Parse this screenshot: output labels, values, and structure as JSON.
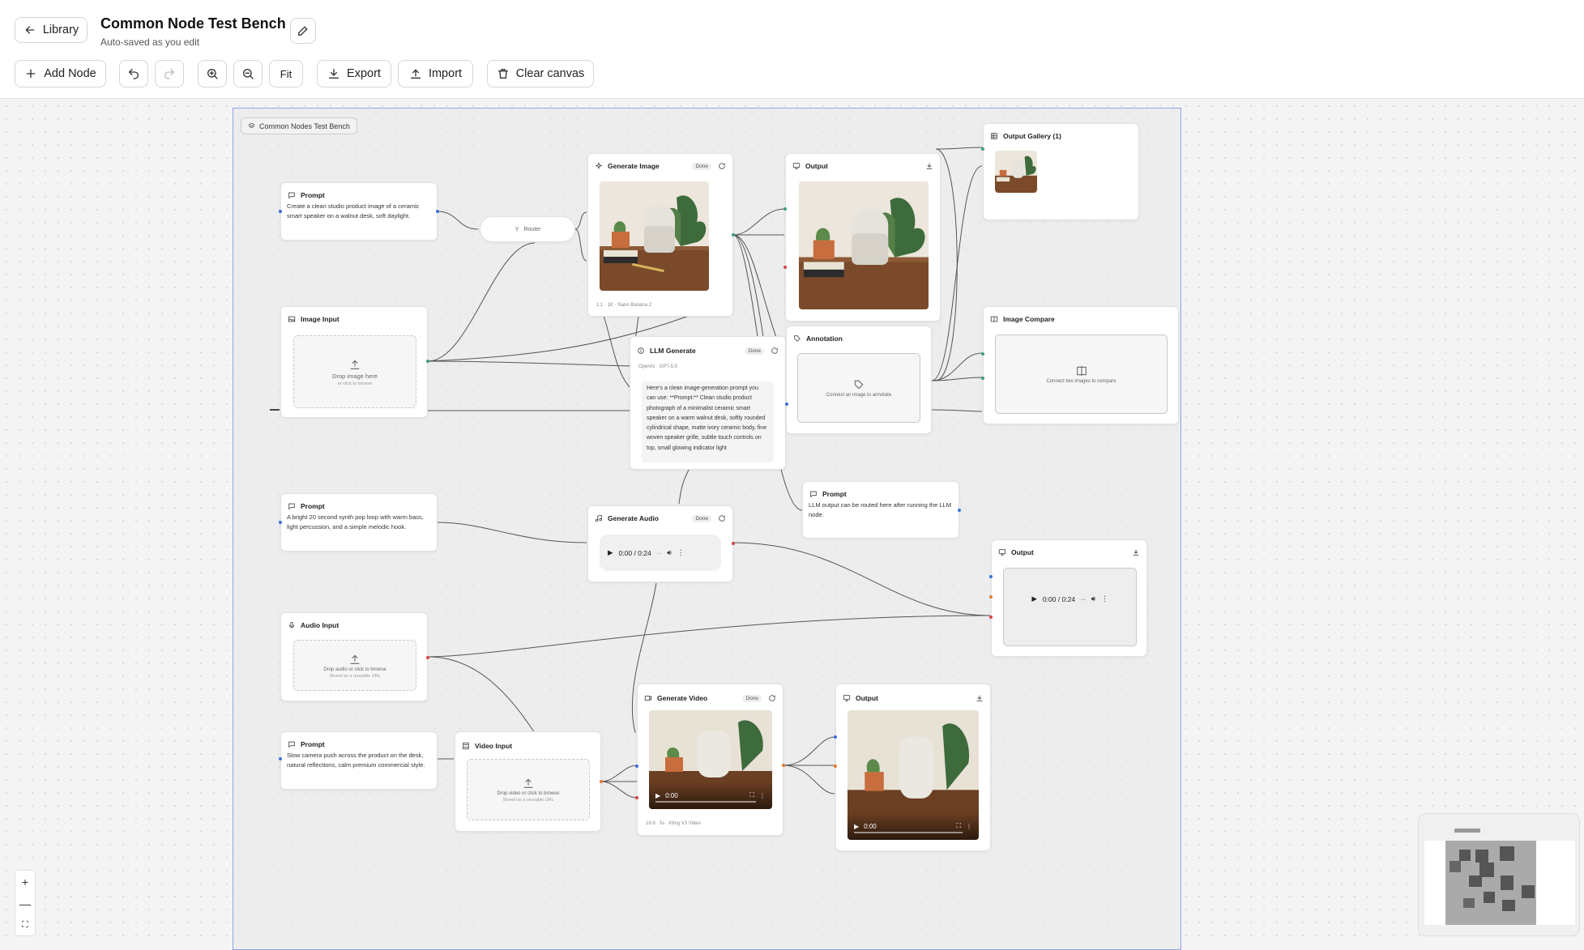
{
  "header": {
    "back_label": "Library",
    "title": "Common Node Test Bench",
    "subtitle": "Auto-saved as you edit"
  },
  "toolbar": {
    "add_node": "Add Node",
    "fit": "Fit",
    "export": "Export",
    "import": "Import",
    "clear": "Clear canvas"
  },
  "group": {
    "label": "Common Nodes Test Bench"
  },
  "nodes": {
    "prompt1": {
      "title": "Prompt",
      "text": "Create a clean studio product image of a ceramic smart speaker on a walnut desk, soft daylight."
    },
    "router": {
      "title": "Router"
    },
    "gen_image": {
      "title": "Generate Image",
      "status": "Done",
      "meta": [
        "1:1",
        "1K",
        "Nano Banana 2"
      ]
    },
    "output1": {
      "title": "Output"
    },
    "gallery": {
      "title": "Output Gallery (1)"
    },
    "image_input": {
      "title": "Image Input",
      "drop": "Drop image here",
      "drop_sub": "or click to browse"
    },
    "llm": {
      "title": "LLM Generate",
      "status": "Done",
      "model": "OpenAI · GPT-5.5",
      "text": "Here's a clean image-generation prompt you can use: **Prompt:** Clean studio product photograph of a minimalist ceramic smart speaker on a warm walnut desk, softly rounded cylindrical shape, matte ivory ceramic body, fine woven speaker grille, subtle touch controls on top, small glowing indicator light"
    },
    "annotation": {
      "title": "Annotation",
      "text": "Connect an image to annotate"
    },
    "compare": {
      "title": "Image Compare",
      "text": "Connect two images to compare"
    },
    "prompt_llm": {
      "title": "Prompt",
      "text": "LLM output can be routed here after running the LLM node."
    },
    "prompt2": {
      "title": "Prompt",
      "text": "A bright 20 second synth pop loop with warm bass, light percussion, and a simple melodic hook."
    },
    "gen_audio": {
      "title": "Generate Audio",
      "status": "Done",
      "time": "0:00 / 0:24"
    },
    "output_audio": {
      "title": "Output",
      "time": "0:00 / 0:24"
    },
    "audio_input": {
      "title": "Audio Input",
      "drop": "Drop audio or click to browse",
      "drop_sub": "Stored as a reusable URL"
    },
    "prompt3": {
      "title": "Prompt",
      "text": "Slow camera push across the product on the desk, natural reflections, calm premium commercial style."
    },
    "video_input": {
      "title": "Video Input",
      "drop": "Drop video or click to browse",
      "drop_sub": "Stored as a reusable URL"
    },
    "gen_video": {
      "title": "Generate Video",
      "status": "Done",
      "time": "0:00",
      "meta": [
        "16:9",
        "5s",
        "Kling V3 Video"
      ]
    },
    "output_video": {
      "title": "Output",
      "time": "0:00"
    }
  },
  "colors": {
    "accent": "#8fa6e6",
    "handle_blue": "#3b6fd8",
    "handle_red": "#d64545",
    "handle_green": "#3f9e7c",
    "handle_orange": "#e07a2e"
  }
}
